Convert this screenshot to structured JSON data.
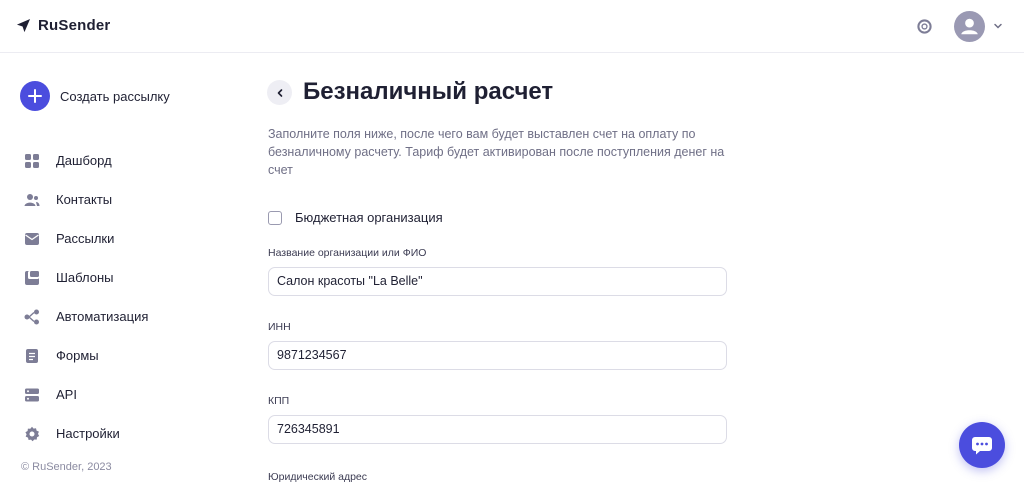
{
  "brand": {
    "name": "RuSender",
    "color": "#4b4dde"
  },
  "header": {
    "help_icon": "lifebuoy-icon",
    "avatar_icon": "user-avatar-icon",
    "menu_icon": "chevron-down-icon"
  },
  "sidebar": {
    "create_label": "Создать рассылку",
    "items": [
      {
        "label": "Дашборд",
        "icon": "dashboard-icon"
      },
      {
        "label": "Контакты",
        "icon": "contacts-icon"
      },
      {
        "label": "Рассылки",
        "icon": "mailings-icon"
      },
      {
        "label": "Шаблоны",
        "icon": "templates-icon"
      },
      {
        "label": "Автоматизация",
        "icon": "automation-icon"
      },
      {
        "label": "Формы",
        "icon": "forms-icon"
      },
      {
        "label": "API",
        "icon": "api-icon"
      },
      {
        "label": "Настройки",
        "icon": "settings-icon"
      }
    ],
    "copyright": "© RuSender, 2023"
  },
  "main": {
    "title": "Безналичный расчет",
    "description": "Заполните поля ниже, после чего вам будет выставлен счет на оплату по безналичному расчету. Тариф будет активирован после поступления денег на счет",
    "budget_checkbox_label": "Бюджетная организация",
    "budget_checked": false,
    "fields": {
      "org_name": {
        "label": "Название организации или ФИО",
        "value": "Салон красоты \"La Belle\""
      },
      "inn": {
        "label": "ИНН",
        "value": "9871234567"
      },
      "kpp": {
        "label": "КПП",
        "value": "726345891"
      },
      "address": {
        "label": "Юридический адрес"
      }
    }
  }
}
